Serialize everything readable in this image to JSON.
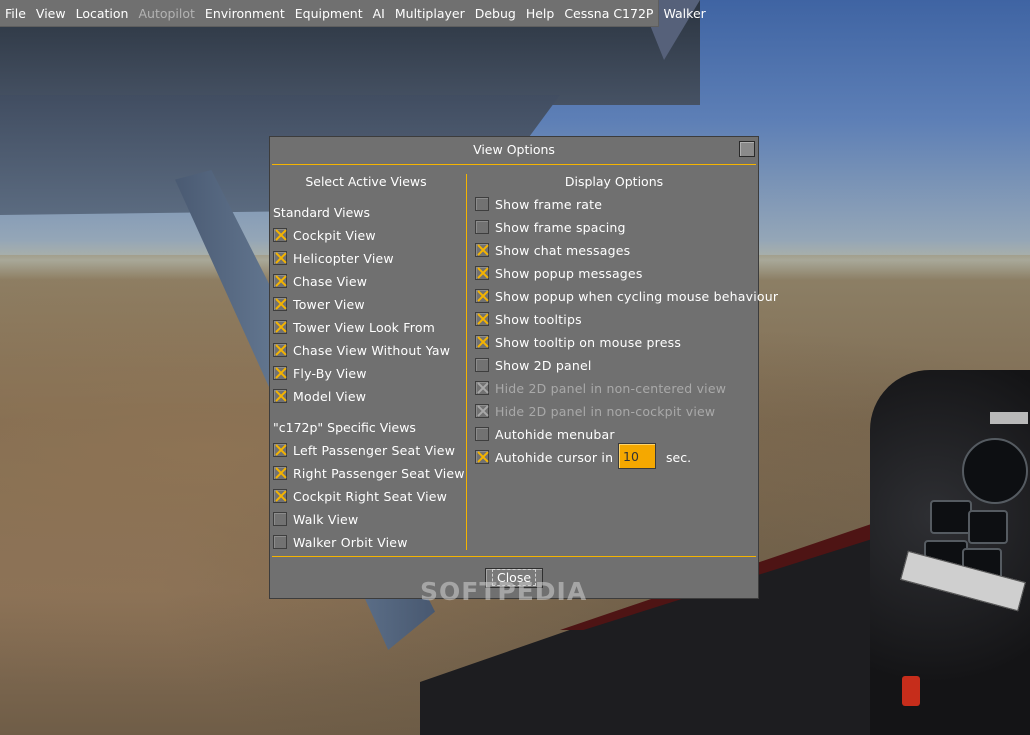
{
  "menubar": {
    "items": [
      {
        "label": "File",
        "enabled": true
      },
      {
        "label": "View",
        "enabled": true
      },
      {
        "label": "Location",
        "enabled": true
      },
      {
        "label": "Autopilot",
        "enabled": false
      },
      {
        "label": "Environment",
        "enabled": true
      },
      {
        "label": "Equipment",
        "enabled": true
      },
      {
        "label": "AI",
        "enabled": true
      },
      {
        "label": "Multiplayer",
        "enabled": true
      },
      {
        "label": "Debug",
        "enabled": true
      },
      {
        "label": "Help",
        "enabled": true
      },
      {
        "label": "Cessna C172P",
        "enabled": true
      },
      {
        "label": "Walker",
        "enabled": true
      }
    ]
  },
  "dialog": {
    "title": "View Options",
    "left_column_title": "Select Active Views",
    "right_column_title": "Display Options",
    "standard_views_label": "Standard Views",
    "standard_views": [
      {
        "label": "Cockpit View",
        "checked": true
      },
      {
        "label": "Helicopter View",
        "checked": true
      },
      {
        "label": "Chase View",
        "checked": true
      },
      {
        "label": "Tower View",
        "checked": true
      },
      {
        "label": "Tower View Look From",
        "checked": true
      },
      {
        "label": "Chase View Without Yaw",
        "checked": true
      },
      {
        "label": "Fly-By View",
        "checked": true
      },
      {
        "label": "Model View",
        "checked": true
      }
    ],
    "specific_views_label": "\"c172p\" Specific Views",
    "specific_views": [
      {
        "label": "Left Passenger Seat View",
        "checked": true
      },
      {
        "label": "Right Passenger Seat View",
        "checked": true
      },
      {
        "label": "Cockpit Right Seat View",
        "checked": true
      },
      {
        "label": "Walk View",
        "checked": false
      },
      {
        "label": "Walker Orbit View",
        "checked": false
      }
    ],
    "display_options": [
      {
        "label": "Show frame rate",
        "checked": false,
        "enabled": true
      },
      {
        "label": "Show frame spacing",
        "checked": false,
        "enabled": true
      },
      {
        "label": "Show chat messages",
        "checked": true,
        "enabled": true
      },
      {
        "label": "Show popup messages",
        "checked": true,
        "enabled": true
      },
      {
        "label": "Show popup when cycling mouse behaviour",
        "checked": true,
        "enabled": true
      },
      {
        "label": "Show tooltips",
        "checked": true,
        "enabled": true
      },
      {
        "label": "Show tooltip on mouse press",
        "checked": true,
        "enabled": true
      },
      {
        "label": "Show 2D panel",
        "checked": false,
        "enabled": true
      },
      {
        "label": "Hide 2D panel in non-centered view",
        "checked": true,
        "enabled": false
      },
      {
        "label": "Hide 2D panel in non-cockpit view",
        "checked": true,
        "enabled": false
      },
      {
        "label": "Autohide menubar",
        "checked": false,
        "enabled": true
      },
      {
        "label": "Autohide cursor in",
        "checked": true,
        "enabled": true
      }
    ],
    "autohide_cursor_seconds": "10",
    "autohide_cursor_unit": "sec.",
    "close_label": "Close"
  },
  "watermark": "SOFTPEDIA",
  "colors": {
    "accent": "#f5b400",
    "panel_bg": "#707070",
    "input_bg": "#f5a800"
  }
}
